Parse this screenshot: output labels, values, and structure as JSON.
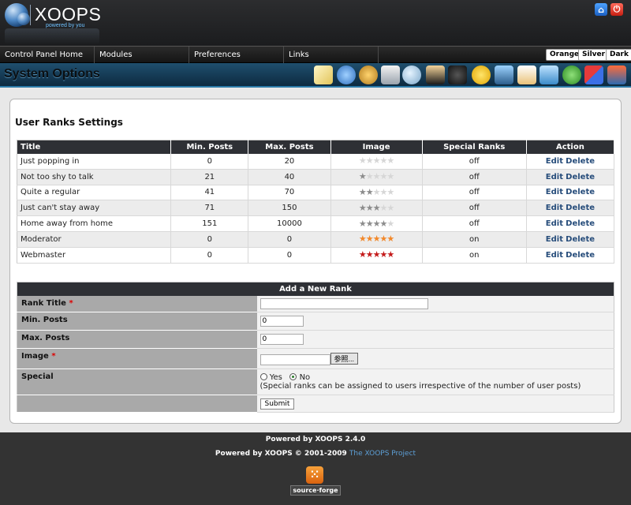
{
  "header": {
    "logo_text": "XOOPS",
    "logo_sub": "powered by you",
    "icons": [
      "home-icon",
      "logout-icon"
    ]
  },
  "nav": {
    "items": [
      "Control Panel Home",
      "Modules",
      "Preferences",
      "Links"
    ],
    "themes": [
      "Orange",
      "Silver",
      "Dark"
    ]
  },
  "toolbar": {
    "title": "System Options",
    "icons": [
      "notepad-icon",
      "globe-icon",
      "users-icon",
      "house-icon",
      "magnifier-icon",
      "user-icon",
      "star-icon",
      "smiley-icon",
      "monitor-icon",
      "package-icon",
      "images-icon",
      "groups-icon",
      "blocks-icon",
      "display-icon"
    ]
  },
  "page": {
    "heading": "User Ranks Settings"
  },
  "ranks_table": {
    "headers": [
      "Title",
      "Min. Posts",
      "Max. Posts",
      "Image",
      "Special Ranks",
      "Action"
    ],
    "edit_label": "Edit",
    "delete_label": "Delete",
    "rows": [
      {
        "title": "Just popping in",
        "min": "0",
        "max": "20",
        "stars": 0,
        "star_color": "#bdbdbd",
        "special": "off"
      },
      {
        "title": "Not too shy to talk",
        "min": "21",
        "max": "40",
        "stars": 1,
        "star_color": "#8c8c8c",
        "special": "off"
      },
      {
        "title": "Quite a regular",
        "min": "41",
        "max": "70",
        "stars": 2,
        "star_color": "#8c8c8c",
        "special": "off"
      },
      {
        "title": "Just can't stay away",
        "min": "71",
        "max": "150",
        "stars": 3,
        "star_color": "#8c8c8c",
        "special": "off"
      },
      {
        "title": "Home away from home",
        "min": "151",
        "max": "10000",
        "stars": 4,
        "star_color": "#8c8c8c",
        "special": "off"
      },
      {
        "title": "Moderator",
        "min": "0",
        "max": "0",
        "stars": 5,
        "star_color": "#f2882a",
        "special": "on"
      },
      {
        "title": "Webmaster",
        "min": "0",
        "max": "0",
        "stars": 5,
        "star_color": "#c41a1a",
        "special": "on"
      }
    ]
  },
  "form": {
    "title": "Add a New Rank",
    "rank_title_label": "Rank Title",
    "min_label": "Min. Posts",
    "max_label": "Max. Posts",
    "image_label": "Image",
    "special_label": "Special",
    "required_mark": "*",
    "min_value": "0",
    "max_value": "0",
    "browse_label": "参照...",
    "yes_label": "Yes",
    "no_label": "No",
    "special_hint": "(Special ranks can be assigned to users irrespective of the number of user posts)",
    "submit_label": "Submit"
  },
  "footer": {
    "version": "Powered by XOOPS 2.4.0",
    "powered_prefix": "Powered by XOOPS © 2001-2009",
    "project_link": "The XOOPS Project",
    "badge_text": "source·forge"
  }
}
